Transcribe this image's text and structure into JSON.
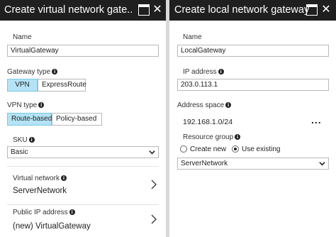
{
  "left_blade": {
    "title": "Create virtual network gate...",
    "name_label": "Name",
    "name_value": "VirtualGateway",
    "gateway_type_label": "Gateway type",
    "gateway_type_options": [
      "VPN",
      "ExpressRoute"
    ],
    "gateway_type_selected": "VPN",
    "vpn_type_label": "VPN type",
    "vpn_type_options": [
      "Route-based",
      "Policy-based"
    ],
    "vpn_type_selected": "Route-based",
    "sku_label": "SKU",
    "sku_value": "Basic",
    "virtual_network_label": "Virtual network",
    "virtual_network_value": "ServerNetwork",
    "public_ip_label": "Public IP address",
    "public_ip_value": "(new) VirtualGateway"
  },
  "right_blade": {
    "title": "Create local network gateway",
    "name_label": "Name",
    "name_value": "LocalGateway",
    "ip_label": "IP address",
    "ip_value": "203.0.113.1",
    "address_space_label": "Address space",
    "address_space_value": "192.168.1.0/24",
    "more_label": "...",
    "resource_group_label": "Resource group",
    "resource_group_options": [
      "Create new",
      "Use existing"
    ],
    "resource_group_selected": "Use existing",
    "resource_group_value": "ServerNetwork"
  },
  "icons": {
    "info": "info-icon",
    "maximize": "maximize-icon",
    "close": "close-icon",
    "chevron_down": "chevron-down-icon",
    "chevron_right": "chevron-right-icon"
  },
  "colors": {
    "titlebar_bg": "#1f1f1f",
    "selected_option_bg": "#b4e3f5",
    "field_border": "#b8b8b8"
  }
}
